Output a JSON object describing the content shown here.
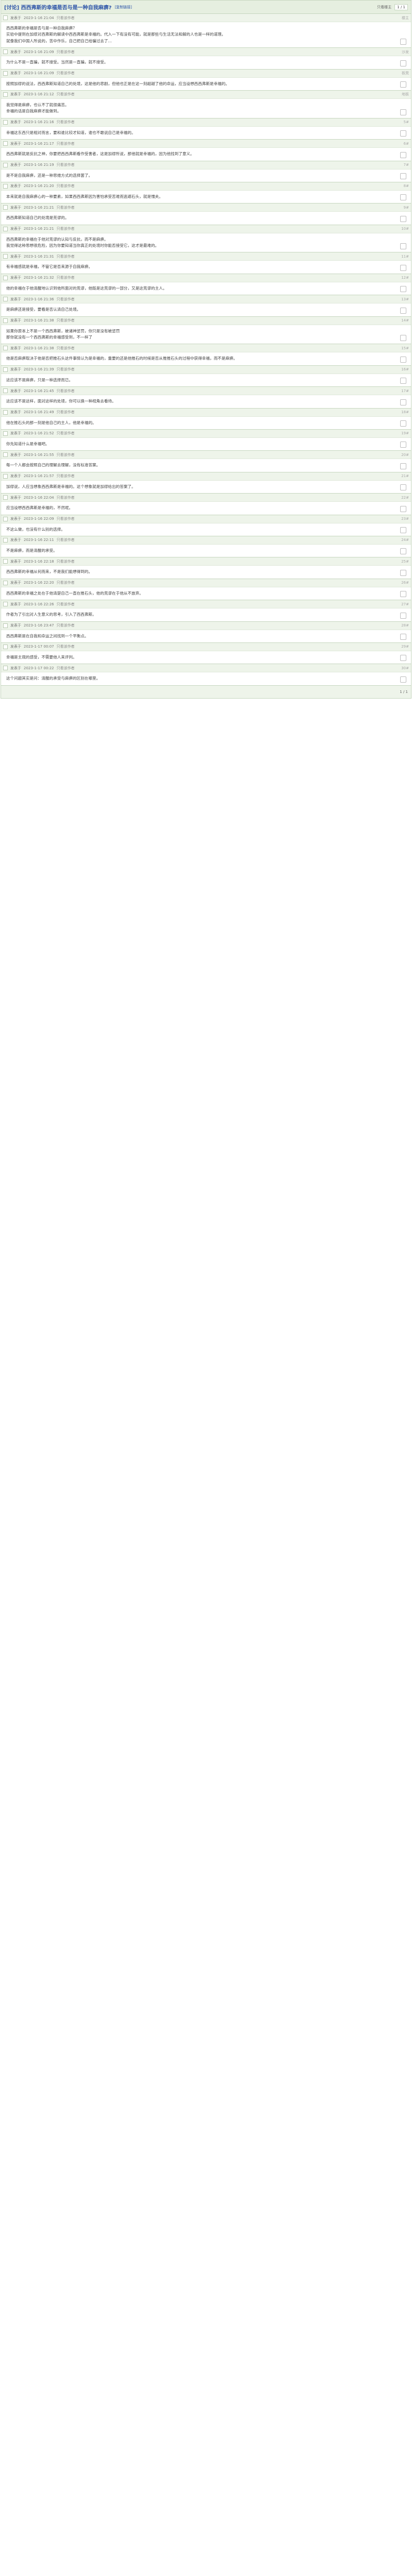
{
  "header": {
    "title": "[讨论] 西西弗斯的幸福是否与是一种自我麻痹?",
    "link": "[复制链接]",
    "author_only": "只看楼主",
    "page": "1 / 1"
  },
  "posts": [
    {
      "author": "发表于",
      "date": "2023-1-16 21:04",
      "label": "只看该作者",
      "floor": "楼主",
      "lines": [
        "西西弗斯的幸福是否与是一种自我麻痹?",
        "实验中提到在加缪对西弗斯的解读中西西弗斯是幸福的。代入一下有没有可能，就是那些与生活无法和解的人也是一样的道理。",
        "就像我们中国人所说的，苦中作乐，自己把自己给骗过去了..."
      ],
      "quotes": []
    },
    {
      "author": "发表于",
      "date": "2023-1-16 21:09",
      "label": "只看该作者",
      "floor": "沙发",
      "lines": [
        "为什么不是一直骗，就不接受。当然是一直骗，就不接受。"
      ],
      "quotes": []
    },
    {
      "author": "发表于",
      "date": "2023-1-16 21:09",
      "label": "只看该作者",
      "floor": "板凳",
      "lines": [
        "按照加缪的说法，西西弗斯知道自己的处境，这是他的悲剧，但他也正是在这一刻超越了他的命运，应当设想西西弗斯是幸福的。"
      ],
      "quotes": []
    },
    {
      "author": "发表于",
      "date": "2023-1-16 21:12",
      "label": "只看该作者",
      "floor": "地板",
      "lines": [
        "我觉得是麻痹，也认不了就很痛苦。",
        "幸福的话是自我麻痹才能做到。"
      ],
      "quotes": []
    },
    {
      "author": "发表于",
      "date": "2023-1-16 21:16",
      "label": "只看该作者",
      "floor": "5#",
      "lines": [
        "幸福这东西只是相对而言，要和谁比较才知道，谁也不敢说自己是幸福的。"
      ],
      "quotes": []
    },
    {
      "author": "发表于",
      "date": "2023-1-16 21:17",
      "label": "只看该作者",
      "floor": "6#",
      "lines": [
        "西西弗斯就是反抗之神，你要把西西弗斯看作受害者，这是加缪所说，那他就是幸福的，因为他找到了意义。"
      ],
      "quotes": []
    },
    {
      "author": "发表于",
      "date": "2023-1-16 21:19",
      "label": "只看该作者",
      "floor": "7#",
      "lines": [
        "是不是自我麻痹，还是一种思维方式的选择罢了。"
      ],
      "quotes": []
    },
    {
      "author": "发表于",
      "date": "2023-1-16 21:20",
      "label": "只看该作者",
      "floor": "8#",
      "lines": [
        "本来就是自我麻痹心的一种要素，如果西西弗斯因为害怕承受苦难而逃避石头，就是懦夫。"
      ],
      "quotes": []
    },
    {
      "author": "发表于",
      "date": "2023-1-16 21:21",
      "label": "只看该作者",
      "floor": "9#",
      "lines": [
        "西西弗斯知道自己的处境是荒谬的。"
      ],
      "quotes": []
    },
    {
      "author": "发表于",
      "date": "2023-1-16 21:21",
      "label": "只看该作者",
      "floor": "10#",
      "lines": [
        "西西弗斯的幸福在于他对荒谬的认知与反抗，而不是麻痹。",
        "我觉得这种思想很危险，因为你要知道当你真正的处境时你能否接受它，这才是最难的。"
      ],
      "quotes": []
    },
    {
      "author": "发表于",
      "date": "2023-1-16 21:31",
      "label": "只看该作者",
      "floor": "11#",
      "lines": [
        "有幸福感就是幸福，不管它是否来源于自我麻痹。"
      ],
      "quotes": []
    },
    {
      "author": "发表于",
      "date": "2023-1-16 21:32",
      "label": "只看该作者",
      "floor": "12#",
      "lines": [
        "他的幸福在于他清醒地认识到他所面对的荒谬，他既是这荒谬的一部分，又是这荒谬的主人。"
      ],
      "quotes": []
    },
    {
      "author": "发表于",
      "date": "2023-1-16 21:36",
      "label": "只看该作者",
      "floor": "13#",
      "lines": [
        "是麻痹还是接受，要看是否认清自己处境。"
      ],
      "quotes": []
    },
    {
      "author": "发表于",
      "date": "2023-1-16 21:38",
      "label": "只看该作者",
      "floor": "14#",
      "lines": [
        "如果你原本上不是一个西西弗斯，被诸神惩罚，你只是没有被惩罚",
        "那你就没有一个西西弗斯的幸福感受到，不一样了"
      ],
      "quotes": []
    },
    {
      "author": "发表于",
      "date": "2023-1-16 21:38",
      "label": "只看该作者",
      "floor": "15#",
      "lines": [
        "他是否麻痹取决于他是否把推石头这件事情认为是幸福的，重要的还是他推石的时候是否从推推石头的过程中获得幸福，而不是麻痹。"
      ],
      "quotes": []
    },
    {
      "author": "发表于",
      "date": "2023-1-16 21:39",
      "label": "只看该作者",
      "floor": "16#",
      "lines": [
        "这应该不是麻痹，只是一种选择而已。"
      ],
      "quotes": []
    },
    {
      "author": "发表于",
      "date": "2023-1-16 21:45",
      "label": "只看该作者",
      "floor": "17#",
      "lines": [
        "这应该不是这样，面对这样的处境，你可以换一种视角去看待。"
      ],
      "quotes": []
    },
    {
      "author": "发表于",
      "date": "2023-1-16 21:49",
      "label": "只看该作者",
      "floor": "18#",
      "lines": [
        "他在推石头的那一刻是他自己的主人，他是幸福的。"
      ],
      "quotes": []
    },
    {
      "author": "发表于",
      "date": "2023-1-16 21:52",
      "label": "只看该作者",
      "floor": "19#",
      "lines": [
        "你先知道什么是幸福吧。"
      ],
      "quotes": []
    },
    {
      "author": "发表于",
      "date": "2023-1-16 21:55",
      "label": "只看该作者",
      "floor": "20#",
      "lines": [
        "每一个人都会按照自己的理解去理解，没有标准答案。"
      ],
      "quotes": []
    },
    {
      "author": "发表于",
      "date": "2023-1-16 21:57",
      "label": "只看该作者",
      "floor": "21#",
      "lines": [
        "加缪说，人应当想象西西弗斯是幸福的。这个想象就是加缪给出的答案了。"
      ],
      "quotes": []
    },
    {
      "author": "发表于",
      "date": "2023-1-16 22:04",
      "label": "只看该作者",
      "floor": "22#",
      "lines": [
        "应当设想西西弗斯是幸福的，不然呢。"
      ],
      "quotes": []
    },
    {
      "author": "发表于",
      "date": "2023-1-16 22:09",
      "label": "只看该作者",
      "floor": "23#",
      "lines": [
        "不这么做，也没有什么别的选择。"
      ],
      "quotes": []
    },
    {
      "author": "发表于",
      "date": "2023-1-16 22:11",
      "label": "只看该作者",
      "floor": "24#",
      "lines": [
        "不是麻痹，而是清醒的承受。"
      ],
      "quotes": []
    },
    {
      "author": "发表于",
      "date": "2023-1-16 22:18",
      "label": "只看该作者",
      "floor": "25#",
      "lines": [
        "西西弗斯的幸福从何而来，不是我们能想得到的。"
      ],
      "quotes": []
    },
    {
      "author": "发表于",
      "date": "2023-1-16 22:20",
      "label": "只看该作者",
      "floor": "26#",
      "lines": [
        "西西弗斯的幸福之处在于他清楚自己一直在推石头，他的荒谬在于他从不放弃。"
      ],
      "quotes": []
    },
    {
      "author": "发表于",
      "date": "2023-1-16 22:26",
      "label": "只看该作者",
      "floor": "27#",
      "lines": [
        "作者为了引出对人生意义的思考，引入了西西弗斯。"
      ],
      "quotes": []
    },
    {
      "author": "发表于",
      "date": "2023-1-16 23:47",
      "label": "只看该作者",
      "floor": "28#",
      "lines": [
        "西西弗斯是在自我和命运之间找到一个平衡点。"
      ],
      "quotes": []
    },
    {
      "author": "发表于",
      "date": "2023-1-17 00:07",
      "label": "只看该作者",
      "floor": "29#",
      "lines": [
        "幸福是主观的感受，不需要他人来评判。"
      ],
      "quotes": []
    },
    {
      "author": "发表于",
      "date": "2023-1-17 00:22",
      "label": "只看该作者",
      "floor": "30#",
      "lines": [
        "这个问题其实是问：清醒的承受与麻痹的区别在哪里。"
      ],
      "quotes": []
    }
  ],
  "footer": {
    "page": "1 / 1"
  }
}
